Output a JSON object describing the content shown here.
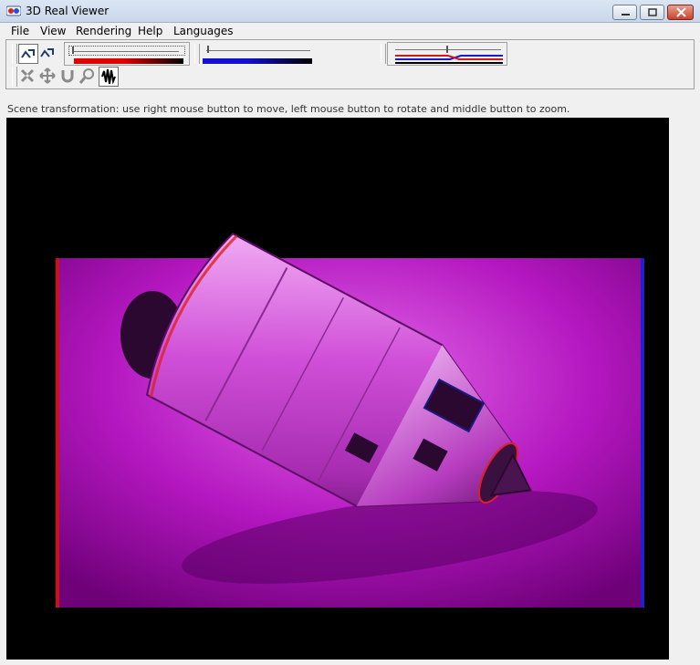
{
  "window": {
    "title": "3D Real Viewer",
    "app_icon": "anaglyph-glasses-icon"
  },
  "menu": {
    "items": [
      "File",
      "View",
      "Rendering",
      "Help",
      "Languages"
    ]
  },
  "toolbar": {
    "mode_buttons": [
      "anaglyph-mode-icon",
      "stereo-mode-icon"
    ],
    "transform_buttons": [
      "select-icon",
      "move-icon",
      "rotate-icon",
      "zoom-icon",
      "stereo-depth-icon"
    ],
    "sliders": {
      "red_level": 0.04,
      "blue_level": 0.04,
      "parallax": 0.55
    }
  },
  "status": {
    "text": "Scene transformation: use right mouse button to move, left mouse button to rotate and middle button to zoom."
  },
  "viewport": {
    "scene": "capsule-render",
    "tint": "#c020d0"
  }
}
